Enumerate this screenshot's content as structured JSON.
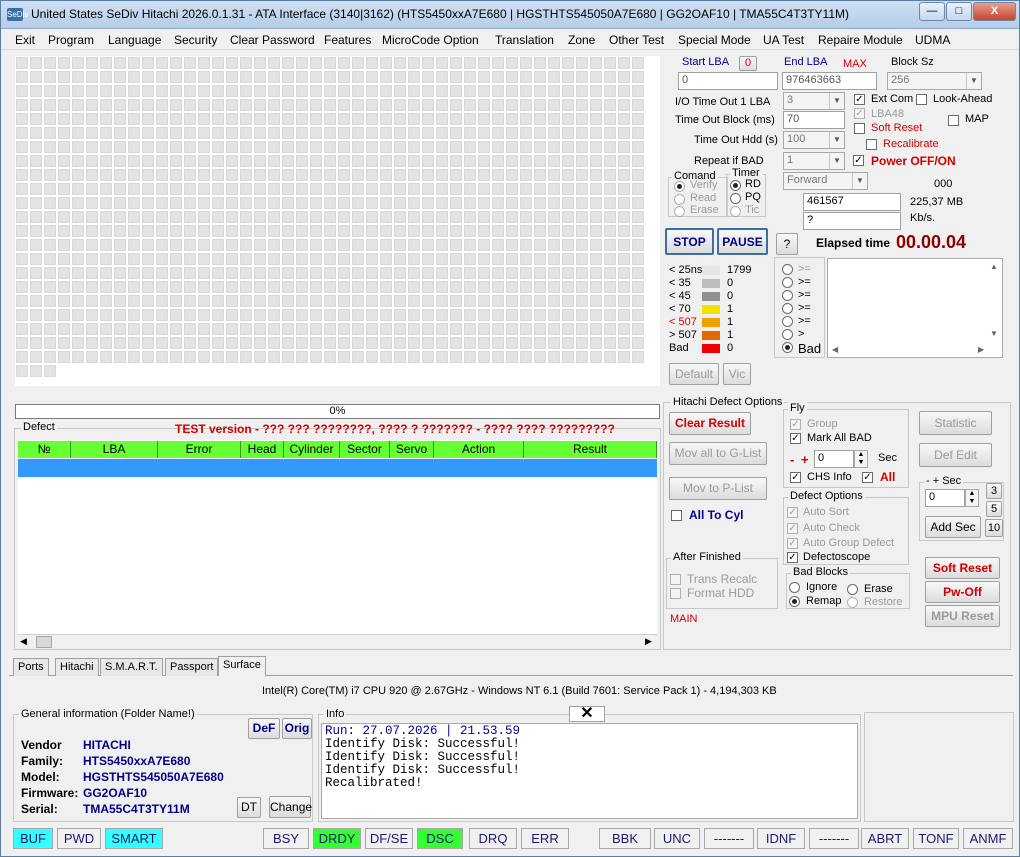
{
  "window": {
    "title": "United States  SeDiv Hitachi  2026.0.1.31 - ATA Interface  (3140|3162) (HTS5450xxA7E680 | HGSTHTS545050A7E680 | GG2OAF10 | TMA55C4T3TY11M)",
    "app_icon": "SeDiv",
    "controls": [
      "—",
      "□",
      "X"
    ]
  },
  "menu": [
    "Exit",
    "Program",
    "Language",
    "Security",
    "Clear Password",
    "Features",
    "MicroCode Option",
    "Translation",
    "Zone",
    "Other Test",
    "Special Mode",
    "UA Test",
    "Repaire Module",
    "UDMA"
  ],
  "progress": {
    "text": "0%",
    "value": 0
  },
  "lba": {
    "start_label": "Start LBA",
    "start_reset": "0",
    "start_value": "0",
    "end_label": "End LBA",
    "end_max": "MAX",
    "end_value": "976463663",
    "block_label": "Block Sz",
    "block_value": "256"
  },
  "settings": {
    "io_timeout_label": "I/O Time Out 1 LBA",
    "io_timeout_value": "3",
    "timeout_block_label": "Time Out Block (ms)",
    "timeout_block_value": "70",
    "timeout_hdd_label": "Time Out Hdd (s)",
    "timeout_hdd_value": "100",
    "repeat_label": "Repeat if BAD",
    "repeat_value": "1",
    "direction_value": "Forward",
    "ext_com": "Ext Com",
    "look_ahead": "Look-Ahead",
    "lba48": "LBA48",
    "map": "MAP",
    "soft_reset": "Soft Reset",
    "recalibrate": "Recalibrate",
    "power": "Power OFF/ON"
  },
  "comand": {
    "label": "Comand",
    "options": [
      "Verify",
      "Read",
      "Erase"
    ]
  },
  "timer": {
    "label": "Timer",
    "options": [
      "RD",
      "PQ",
      "Tic"
    ]
  },
  "counters": {
    "code": "000",
    "lba": "461567",
    "size": "225,37 MB",
    "speed": "?",
    "speed_unit": "Kb/s."
  },
  "controls": {
    "stop": "STOP",
    "pause": "PAUSE",
    "help": "?",
    "elapsed_label": "Elapsed time",
    "elapsed_value": "00.00.04",
    "default": "Default",
    "vic": "Vic"
  },
  "stats": [
    {
      "label": "< 25ns",
      "value": "1799",
      "color": "#e6e6e6"
    },
    {
      "label": "< 35",
      "value": "0",
      "color": "#bdbdbd"
    },
    {
      "label": "< 45",
      "value": "0",
      "color": "#8f8f8f"
    },
    {
      "label": "< 70",
      "value": "1",
      "color": "#f2e200"
    },
    {
      "label": "< 507",
      "value": "1",
      "color": "#f0a000"
    },
    {
      "label": "> 507",
      "value": "1",
      "color": "#e86800"
    },
    {
      "label": "Bad",
      "value": "0",
      "color": "#ee0000"
    }
  ],
  "filters": [
    ">=",
    ">=",
    ">=",
    ">=",
    ">=",
    ">",
    "Bad"
  ],
  "defect": {
    "label": "Defect",
    "banner": "TEST version - ??? ??? ????????, ???? ? ??????? - ???? ???? ?????????",
    "columns": [
      "№",
      "LBA",
      "Error",
      "Head",
      "Cylinder",
      "Sector",
      "Servo",
      "Action",
      "Result"
    ]
  },
  "hitachi": {
    "label": "Hitachi Defect Options",
    "clear_result": "Clear Result",
    "mov_g": "Mov all to G-List",
    "mov_p": "Mov to P-List",
    "all_to_cyl": "All To Cyl",
    "after_label": "After Finished",
    "trans_recalc": "Trans Recalc",
    "format_hdd": "Format HDD",
    "main": "MAIN",
    "fly_label": "Fly",
    "group": "Group",
    "mark_bad": "Mark All BAD",
    "spin_value": "0",
    "sec": "Sec",
    "minus": "-",
    "plus": "+",
    "chs_info": "CHS Info",
    "all": "All",
    "defect_opt_label": "Defect Options",
    "auto_sort": "Auto Sort",
    "auto_check": "Auto Check",
    "auto_group": "Auto Group Defect",
    "defectoscope": "Defectoscope",
    "bad_blocks_label": "Bad Blocks",
    "ignore": "Ignore",
    "erase": "Erase",
    "remap": "Remap",
    "restore": "Restore",
    "statistic": "Statistic",
    "def_edit": "Def Edit",
    "sec_label": "- + Sec",
    "sec_value": "0",
    "add_sec": "Add Sec",
    "n3": "3",
    "n5": "5",
    "n10": "10",
    "soft_reset_btn": "Soft Reset",
    "pw_off": "Pw-Off",
    "mpu_reset": "MPU Reset"
  },
  "tabs": [
    "Ports",
    "Hitachi",
    "S.M.A.R.T.",
    "Passport",
    "Surface"
  ],
  "sysinfo": "Intel(R) Core(TM) i7 CPU 920  @ 2.67GHz - Windows NT 6.1 (Build 7601: Service Pack 1) -  4,194,303 KB",
  "general": {
    "label": "General information (Folder Name!)",
    "def": "DeF",
    "orig": "Orig",
    "dt": "DT",
    "change": "Change",
    "rows": [
      {
        "k": "Vendor",
        "v": "HITACHI"
      },
      {
        "k": "Family:",
        "v": "HTS5450xxA7E680"
      },
      {
        "k": "Model:",
        "v": "HGSTHTS545050A7E680"
      },
      {
        "k": "Firmware:",
        "v": "GG2OAF10"
      },
      {
        "k": "Serial:",
        "v": "TMA55C4T3TY11M"
      }
    ]
  },
  "info": {
    "label": "Info",
    "lines": [
      "Run: 27.07.2026 | 21.53.59",
      "Identify Disk: Successful!",
      "Identify Disk: Successful!",
      "Identify Disk: Successful!",
      "Recalibrated!"
    ]
  },
  "status": [
    "BUF",
    "PWD",
    "SMART",
    "BSY",
    "DRDY",
    "DF/SE",
    "DSC",
    "DRQ",
    "ERR",
    "BBK",
    "UNC",
    "-------",
    "IDNF",
    "-------",
    "ABRT",
    "TONF",
    "ANMF"
  ],
  "status_colors": {
    "cyan": "#33ffff",
    "green": "#33ff33"
  }
}
